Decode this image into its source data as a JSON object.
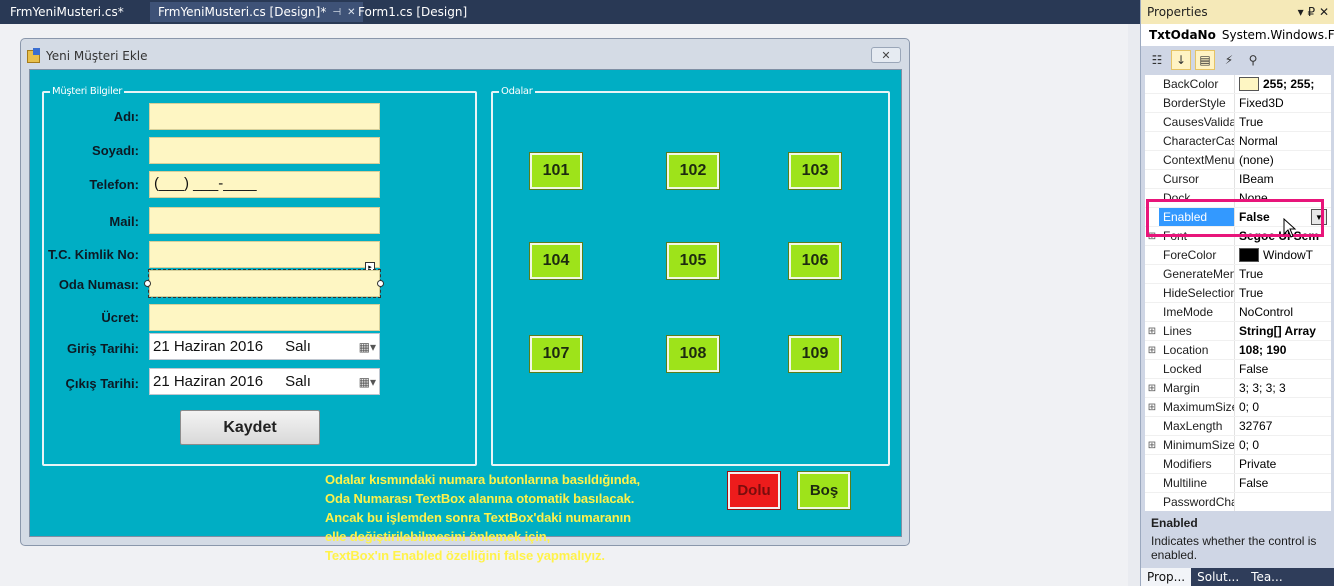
{
  "tabs": [
    {
      "label": "FrmYeniMusteri.cs*"
    },
    {
      "label": "FrmYeniMusteri.cs [Design]*",
      "active": true,
      "pin": "⊣",
      "close": "✕"
    },
    {
      "label": "Form1.cs [Design]"
    }
  ],
  "form": {
    "title": "Yeni Müşteri Ekle",
    "close": "✕",
    "groups": {
      "customer": "Müşteri Bilgiler",
      "rooms": "Odalar"
    },
    "labels": {
      "name": "Adı:",
      "surname": "Soyadı:",
      "phone": "Telefon:",
      "mail": "Mail:",
      "tc": "T.C. Kimlik No:",
      "room_no": "Oda Numası:",
      "fee": "Ücret:",
      "checkin": "Giriş Tarihi:",
      "checkout": "Çıkış Tarihi:"
    },
    "phone_mask": "(___) ___-____",
    "checkin_date": {
      "date": "21 Haziran  2016",
      "day": "Salı"
    },
    "checkout_date": {
      "date": "21 Haziran  2016",
      "day": "Salı"
    },
    "save_label": "Kaydet",
    "rooms": [
      "101",
      "102",
      "103",
      "104",
      "105",
      "106",
      "107",
      "108",
      "109"
    ],
    "dolu_label": "Dolu",
    "bos_label": "Boş",
    "accent": "#00aec4",
    "room_color": "#9ee31a",
    "dolu_color": "#ed1c1c"
  },
  "note": [
    "Odalar kısmındaki numara butonlarına basıldığında,",
    "Oda Numarası TextBox alanına otomatik basılacak.",
    "Ancak bu işlemden sonra TextBox'daki numaranın",
    "elle değiştirilebilmesini önlemek için,",
    "TextBox'ın Enabled özelliğini false yapmalıyız."
  ],
  "properties": {
    "title": "Properties",
    "title_controls": "▾ ₽ ✕",
    "object_name": "TxtOdaNo",
    "object_type": "System.Windows.Fo",
    "rows": [
      {
        "name": "BackColor",
        "value": "255; 255;",
        "swatch": "#fef6c3",
        "bold": true
      },
      {
        "name": "BorderStyle",
        "value": "Fixed3D"
      },
      {
        "name": "CausesValidat",
        "value": "True"
      },
      {
        "name": "CharacterCas",
        "value": "Normal"
      },
      {
        "name": "ContextMenu",
        "value": "(none)"
      },
      {
        "name": "Cursor",
        "value": "IBeam"
      },
      {
        "name": "Dock",
        "value": "None"
      },
      {
        "name": "Enabled",
        "value": "False",
        "bold": true,
        "selected": true
      },
      {
        "name": "Font",
        "value": "Segoe UI Sem",
        "bold": true,
        "expand": "⊞"
      },
      {
        "name": "ForeColor",
        "value": "WindowT",
        "swatch": "#000000"
      },
      {
        "name": "GenerateMen",
        "value": "True"
      },
      {
        "name": "HideSelection",
        "value": "True"
      },
      {
        "name": "ImeMode",
        "value": "NoControl"
      },
      {
        "name": "Lines",
        "value": "String[] Array",
        "bold": true,
        "expand": "⊞"
      },
      {
        "name": "Location",
        "value": "108; 190",
        "bold": true,
        "expand": "⊞"
      },
      {
        "name": "Locked",
        "value": "False"
      },
      {
        "name": "Margin",
        "value": "3; 3; 3; 3",
        "expand": "⊞"
      },
      {
        "name": "MaximumSize",
        "value": "0; 0",
        "expand": "⊞"
      },
      {
        "name": "MaxLength",
        "value": "32767"
      },
      {
        "name": "MinimumSize",
        "value": "0; 0",
        "expand": "⊞"
      },
      {
        "name": "Modifiers",
        "value": "Private"
      },
      {
        "name": "Multiline",
        "value": "False"
      },
      {
        "name": "PasswordCha",
        "value": ""
      }
    ],
    "desc_title": "Enabled",
    "desc_text": "Indicates whether the control is enabled.",
    "bottom_tabs": [
      "Prop...",
      "Solut...",
      "Tea..."
    ]
  }
}
